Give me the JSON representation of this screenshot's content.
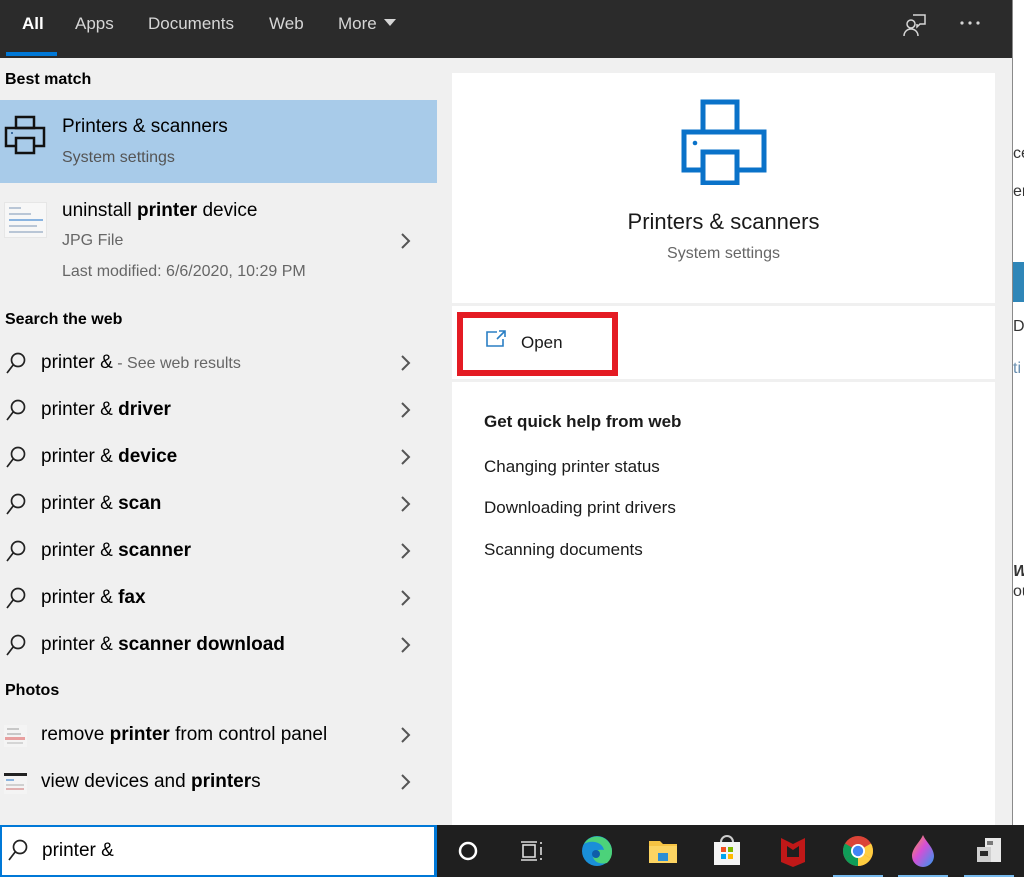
{
  "tabs": [
    {
      "label": "All",
      "active": true
    },
    {
      "label": "Apps",
      "active": false
    },
    {
      "label": "Documents",
      "active": false
    },
    {
      "label": "Web",
      "active": false
    },
    {
      "label": "More",
      "active": false
    }
  ],
  "top_icons": [
    "feedback-icon",
    "more-options-icon"
  ],
  "left": {
    "best_match_heading": "Best match",
    "best_match": {
      "title_bold": "Printer",
      "title_rest": "s & scanners",
      "subtitle": "System settings"
    },
    "file_result": {
      "title_pre": "uninstall ",
      "title_bold": "printer",
      "title_post": " device",
      "type": "JPG File",
      "modified": "Last modified: 6/6/2020, 10:29 PM"
    },
    "web_heading": "Search the web",
    "web_results": [
      {
        "pre": "printer &",
        "bold": "",
        "hint": " - See web results"
      },
      {
        "pre": "printer & ",
        "bold": "driver",
        "hint": ""
      },
      {
        "pre": "printer & ",
        "bold": "device",
        "hint": ""
      },
      {
        "pre": "printer & ",
        "bold": "scan",
        "hint": ""
      },
      {
        "pre": "printer & ",
        "bold": "scanner",
        "hint": ""
      },
      {
        "pre": "printer & ",
        "bold": "fax",
        "hint": ""
      },
      {
        "pre": "printer & ",
        "bold": "scanner download",
        "hint": ""
      }
    ],
    "photos_heading": "Photos",
    "photos": [
      {
        "pre": "remove ",
        "bold": "printer",
        "post": " from control panel"
      },
      {
        "pre": "view devices and ",
        "bold": "printer",
        "post": "s"
      }
    ]
  },
  "search": {
    "query": "printer &"
  },
  "preview": {
    "title": "Printers & scanners",
    "subtitle": "System settings",
    "open_label": "Open",
    "help_heading": "Get quick help from web",
    "help_links": [
      "Changing printer status",
      "Downloading print drivers",
      "Scanning documents"
    ]
  },
  "taskbar": {
    "items": [
      "cortana",
      "task-view",
      "edge",
      "file-explorer",
      "microsoft-store",
      "mcafee",
      "chrome",
      "paint-3d",
      "device-app"
    ]
  },
  "background_window": {
    "fragments": [
      "ce",
      "er",
      "De",
      "ti",
      "Wi",
      "ou"
    ]
  },
  "colors": {
    "accent": "#0078d7",
    "highlight": "#a8cbe9",
    "annotation_red": "#e41b23"
  }
}
